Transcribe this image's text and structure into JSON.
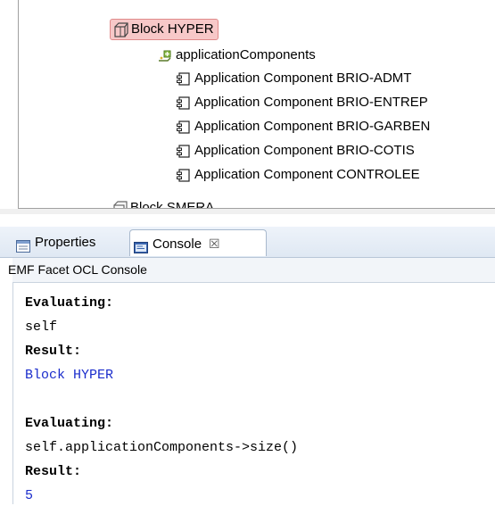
{
  "tree": {
    "selected_node": "Block HYPER",
    "group_node": "applicationComponents",
    "items": [
      "Application Component BRIO-ADMT",
      "Application Component BRIO-ENTREP",
      "Application Component BRIO-GARBEN",
      "Application Component BRIO-COTIS",
      "Application Component CONTROLEE"
    ],
    "cropped_bottom_label": "Block SMERA",
    "colors": {
      "selection_fill": "#f7c8c8",
      "selection_border": "#e08a8a"
    }
  },
  "tabs": {
    "properties_label": "Properties",
    "console_label": "Console",
    "close_glyph": "☒"
  },
  "console": {
    "title": "EMF Facet OCL Console",
    "lines": [
      {
        "text": "Evaluating:",
        "style": "bold"
      },
      {
        "text": "self",
        "style": "normal"
      },
      {
        "text": "Result:",
        "style": "bold"
      },
      {
        "text": "Block HYPER",
        "style": "blue"
      },
      {
        "text": "",
        "style": "normal"
      },
      {
        "text": "Evaluating:",
        "style": "bold"
      },
      {
        "text": "self.applicationComponents->size()",
        "style": "normal"
      },
      {
        "text": "Result:",
        "style": "bold"
      },
      {
        "text": "5",
        "style": "blue"
      }
    ],
    "colors": {
      "result_text": "#1b2dcc"
    }
  }
}
